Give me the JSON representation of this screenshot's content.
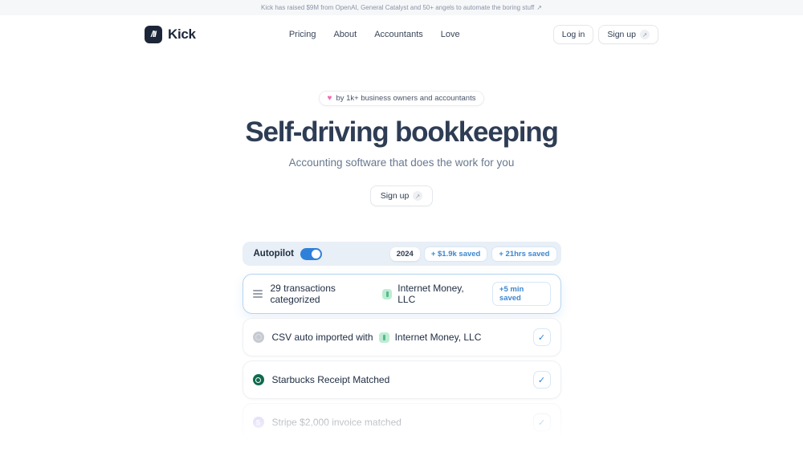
{
  "banner": {
    "text": "Kick has raised $9M from OpenAI, General Catalyst and 50+ angels to automate the boring stuff",
    "arrow": "↗"
  },
  "header": {
    "logo_glyph": "/II",
    "logo_text": "Kick",
    "nav": [
      {
        "label": "Pricing"
      },
      {
        "label": "About"
      },
      {
        "label": "Accountants"
      },
      {
        "label": "Love"
      }
    ],
    "login_label": "Log in",
    "signup_label": "Sign up",
    "signup_arrow": "↗"
  },
  "hero": {
    "badge_heart": "♥",
    "badge_text": "by 1k+ business owners and accountants",
    "title": "Self-driving bookkeeping",
    "subtitle": "Accounting software that does the work for you",
    "cta_label": "Sign up",
    "cta_arrow": "↗"
  },
  "demo": {
    "autopilot_label": "Autopilot",
    "toggle_state": "on",
    "year_badge": "2024",
    "saved_badge_1": "+ $1.9k saved",
    "saved_badge_2": "+ 21hrs saved",
    "check_glyph": "✓",
    "row1": {
      "text": "29 transactions categorized",
      "company": "Internet Money, LLC",
      "time_saved": "+5 min saved"
    },
    "row2": {
      "text": "CSV auto imported with",
      "company": "Internet Money, LLC"
    },
    "row3": {
      "text": "Starbucks Receipt Matched"
    },
    "row4": {
      "text": "Stripe $2,000 invoice matched",
      "stripe_initial": "S"
    }
  },
  "colors": {
    "accent_blue": "#2f80d9",
    "badge_blue_text": "#3c87d0",
    "autopilot_bar_bg": "#e8eff6",
    "highlight_card_border": "#b5d4ef",
    "heading_navy": "#2e3d54",
    "logo_navy": "#1c2638",
    "heart_pink": "#ef6bb0",
    "internet_money_green": "#bdecd2",
    "starbucks_green": "#0f6b4e",
    "stripe_purple": "#b3aef2"
  }
}
